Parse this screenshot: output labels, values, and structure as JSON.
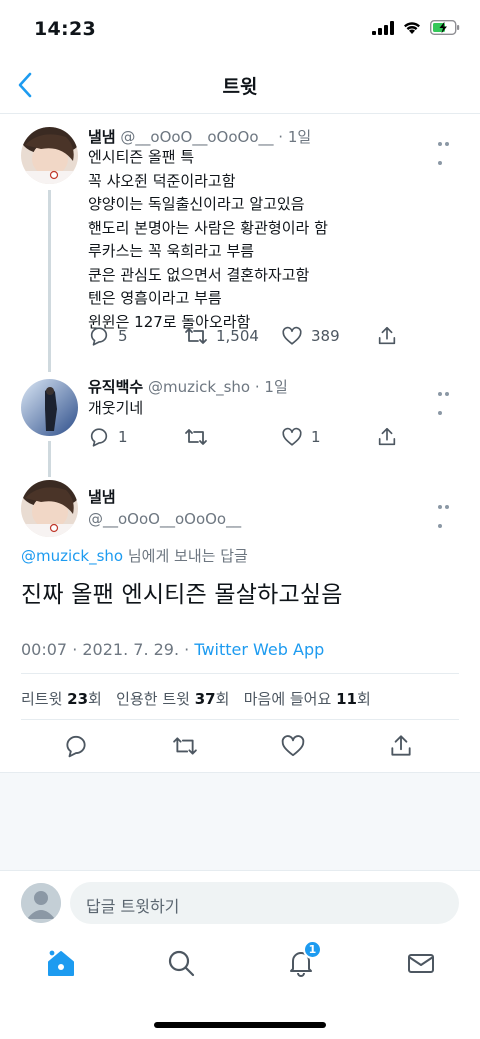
{
  "status_bar": {
    "time": "14:23"
  },
  "nav": {
    "title": "트윗"
  },
  "thread": [
    {
      "name": "낼냄",
      "handle": "@__oOoO__oOoOo__",
      "time": "· 1일",
      "lines": [
        "엔시티즌 올팬 특",
        "꼭 샤오쥔 덕준이라고함",
        "양양이는 독일출신이라고 알고있음",
        "핸도리 본명아는 사람은 황관형이라 함",
        "루카스는 꼭 욱희라고 부름",
        "쿤은 관심도 없으면서 결혼하자고함",
        "텐은 영흠이라고 부름",
        "윈윈은 127로 돌아오라함"
      ],
      "replies": "5",
      "retweets": "1,504",
      "likes": "389"
    },
    {
      "name": "유직백수",
      "handle": "@muzick_sho",
      "time": "· 1일",
      "lines": [
        "개웃기네"
      ],
      "replies": "1",
      "retweets": "",
      "likes": "1"
    }
  ],
  "main_tweet": {
    "name": "낼냄",
    "handle": "@__oOoO__oOoOo__",
    "reply_mention": "@muzick_sho",
    "reply_suffix": " 님에게 보내는 답글",
    "text": "진짜 올팬 엔시티즌 몰살하고싶음",
    "timestamp": "00:07 · 2021. 7. 29. · ",
    "source": "Twitter Web App",
    "stats": {
      "retweet_label": "리트윗 ",
      "retweet_count": "23",
      "retweet_unit": "회",
      "quote_label": "인용한 트윗 ",
      "quote_count": "37",
      "quote_unit": "회",
      "like_label": "마음에 들어요 ",
      "like_count": "11",
      "like_unit": "회"
    }
  },
  "compose": {
    "placeholder": "답글 트윗하기"
  },
  "tab_bar": {
    "notification_badge": "1"
  },
  "colors": {
    "accent": "#1d9bf0",
    "text": "#0f1419",
    "muted": "#6e7781",
    "divider": "#e6ecf0"
  }
}
